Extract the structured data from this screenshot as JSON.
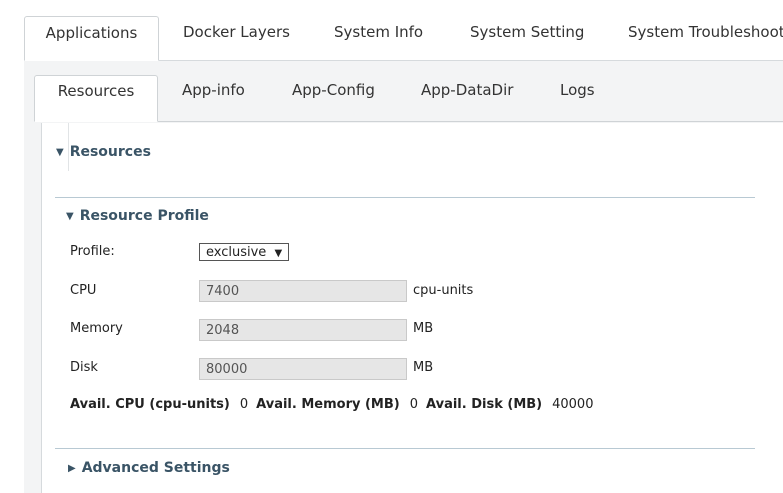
{
  "top_tabs": [
    {
      "label": "Applications",
      "active": true
    },
    {
      "label": "Docker Layers",
      "active": false
    },
    {
      "label": "System Info",
      "active": false
    },
    {
      "label": "System Setting",
      "active": false
    },
    {
      "label": "System Troubleshoot",
      "active": false
    }
  ],
  "sub_tabs": [
    {
      "label": "Resources",
      "active": true
    },
    {
      "label": "App-info",
      "active": false
    },
    {
      "label": "App-Config",
      "active": false
    },
    {
      "label": "App-DataDir",
      "active": false
    },
    {
      "label": "Logs",
      "active": false
    }
  ],
  "resources": {
    "section_title": "Resources",
    "profile_section_title": "Resource Profile",
    "profile": {
      "label": "Profile:",
      "value": "exclusive",
      "arrow": "▼"
    },
    "cpu": {
      "label": "CPU",
      "value": "7400",
      "unit": "cpu-units"
    },
    "memory": {
      "label": "Memory",
      "value": "2048",
      "unit": "MB"
    },
    "disk": {
      "label": "Disk",
      "value": "80000",
      "unit": "MB"
    },
    "avail": {
      "cpu_label": "Avail. CPU (cpu-units)",
      "cpu_value": "0",
      "memory_label": "Avail. Memory (MB)",
      "memory_value": "0",
      "disk_label": "Avail. Disk (MB)",
      "disk_value": "40000"
    },
    "advanced_title": "Advanced Settings"
  },
  "colors": {
    "section_title": "#3a5466",
    "divider": "#b8c9d3",
    "field_bg": "#e6e6e6"
  }
}
